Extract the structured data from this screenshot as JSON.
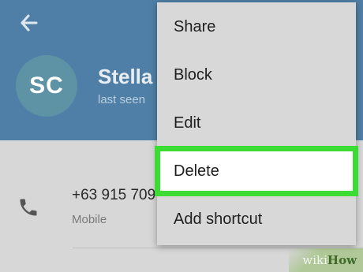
{
  "header": {
    "avatar_initials": "SC",
    "contact_name": "Stella C",
    "status": "last seen"
  },
  "contact": {
    "phone_number": "+63 915 709",
    "phone_type": "Mobile"
  },
  "menu": {
    "items": [
      {
        "label": "Share"
      },
      {
        "label": "Block"
      },
      {
        "label": "Edit"
      },
      {
        "label": "Delete",
        "highlighted": true
      },
      {
        "label": "Add shortcut"
      }
    ]
  },
  "watermark": {
    "wiki": "wiki",
    "how": "How"
  },
  "colors": {
    "header_bg": "#4f7fa6",
    "avatar_bg": "#5e93a5",
    "highlight_border": "#3ddc34",
    "menu_bg": "#d8d8d8"
  },
  "icons": {
    "back": "back-arrow-icon",
    "phone": "phone-icon"
  }
}
